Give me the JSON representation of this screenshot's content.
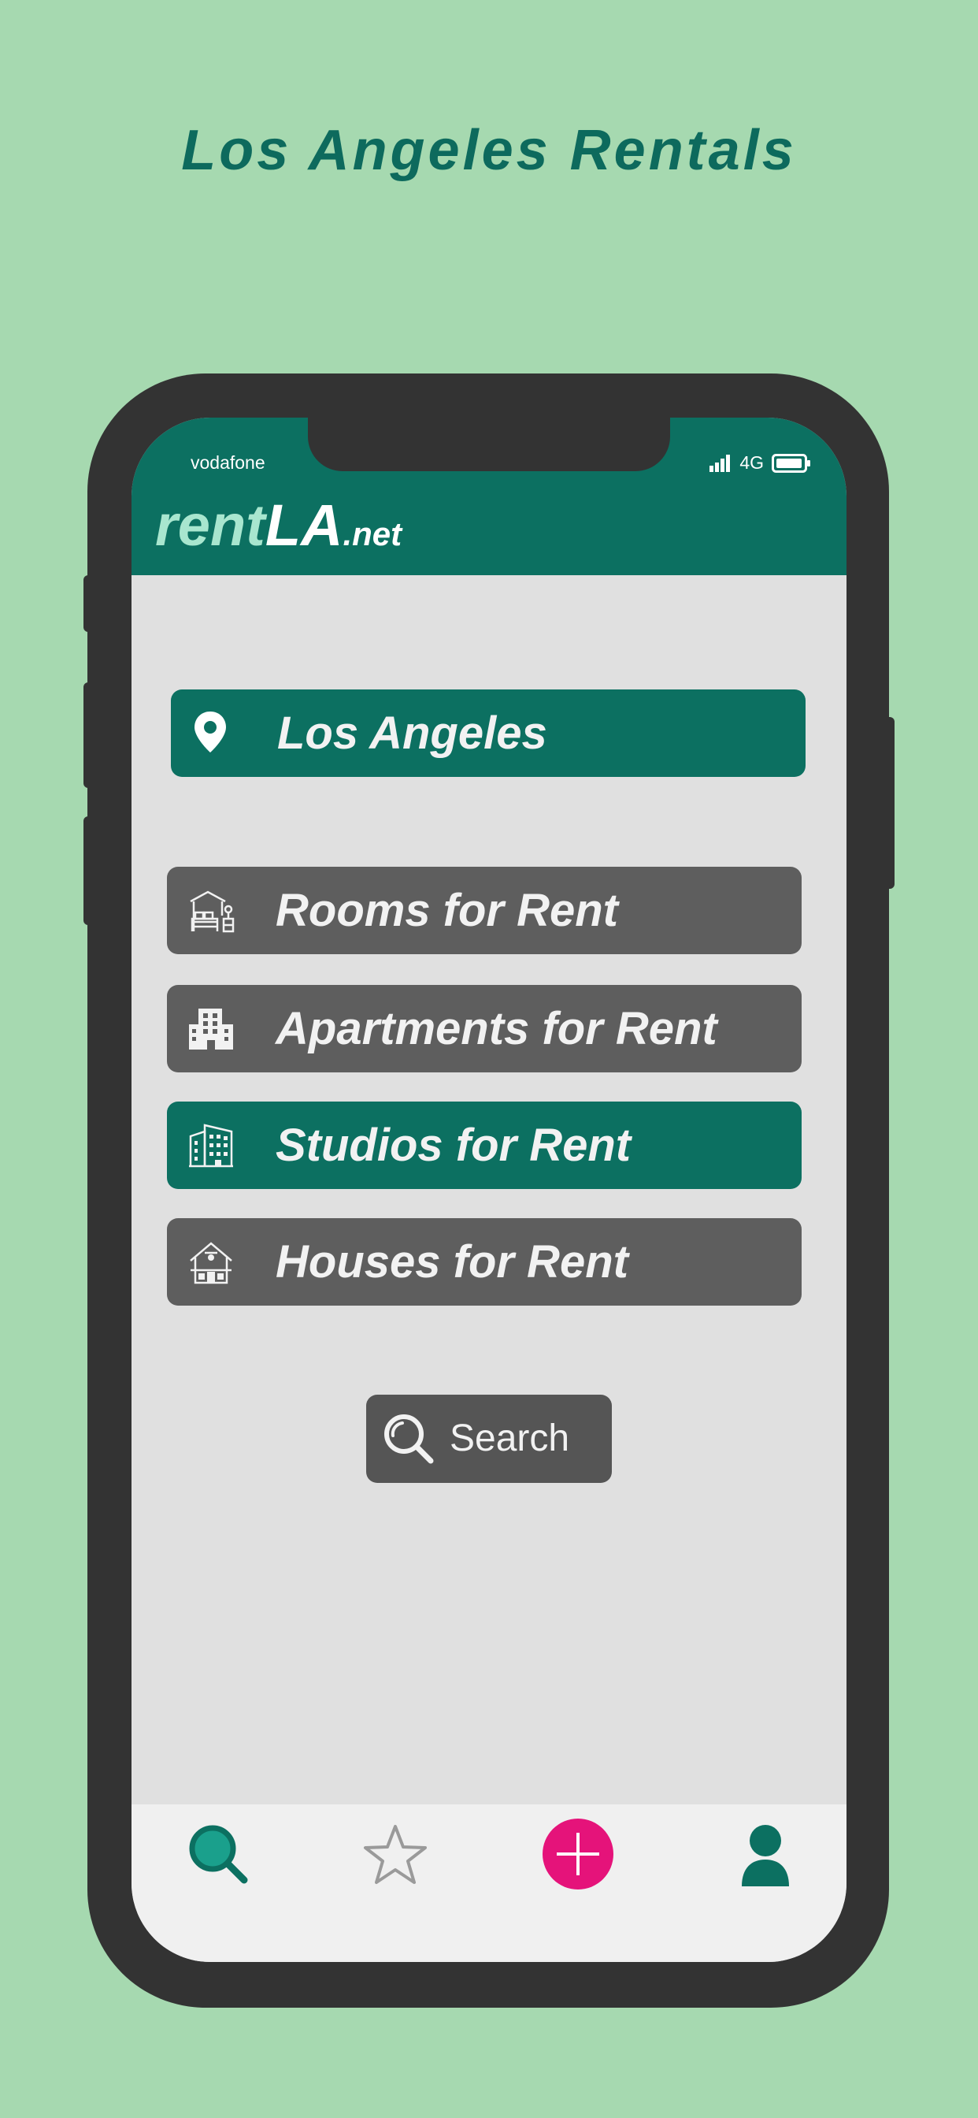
{
  "headline": "Los Angeles Rentals",
  "status_bar": {
    "carrier": "vodafone",
    "network": "4G"
  },
  "header": {
    "logo_part1": "rent",
    "logo_part2": "LA",
    "logo_part3": ".net"
  },
  "location": {
    "label": "Los Angeles",
    "icon": "location-pin-icon"
  },
  "categories": [
    {
      "label": "Rooms for Rent",
      "icon": "bedroom-icon",
      "selected": false
    },
    {
      "label": "Apartments for Rent",
      "icon": "apartment-building-icon",
      "selected": false
    },
    {
      "label": "Studios for Rent",
      "icon": "studio-building-icon",
      "selected": true
    },
    {
      "label": "Houses for Rent",
      "icon": "house-icon",
      "selected": false
    }
  ],
  "search_button": {
    "label": "Search",
    "icon": "search-icon"
  },
  "tab_bar": [
    {
      "name": "search",
      "icon": "search-icon",
      "active": true
    },
    {
      "name": "favorites",
      "icon": "star-icon",
      "active": false
    },
    {
      "name": "add",
      "icon": "plus-icon",
      "active": false
    },
    {
      "name": "profile",
      "icon": "user-icon",
      "active": false
    }
  ],
  "colors": {
    "background": "#a6d9b0",
    "primary": "#0c7061",
    "category_default": "#5e5e5e",
    "accent_add": "#e5137a",
    "phone_frame": "#333333"
  }
}
